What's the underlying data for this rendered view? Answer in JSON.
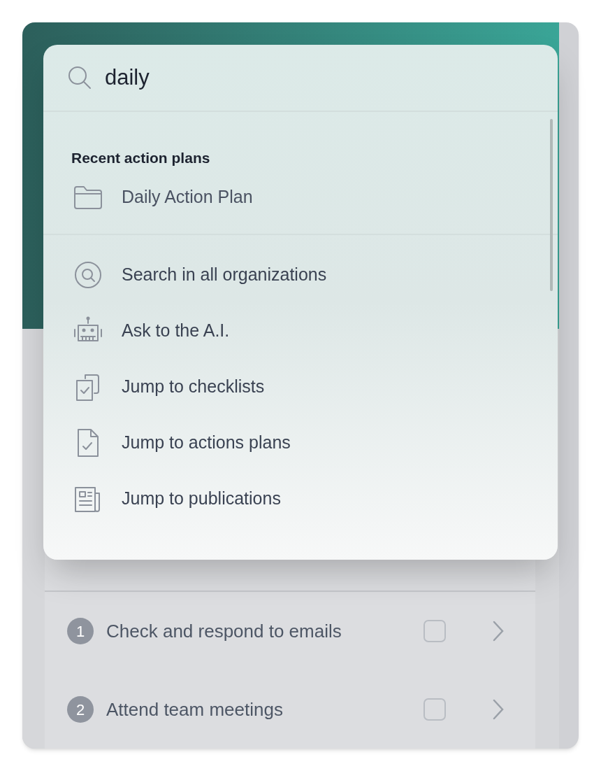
{
  "search": {
    "value": "daily"
  },
  "recent": {
    "heading": "Recent action plans",
    "items": [
      {
        "label": "Daily Action Plan"
      }
    ]
  },
  "actions": [
    {
      "label": "Search in all organizations"
    },
    {
      "label": "Ask to the A.I."
    },
    {
      "label": "Jump to checklists"
    },
    {
      "label": "Jump to actions plans"
    },
    {
      "label": "Jump to publications"
    }
  ],
  "tasks": [
    {
      "number": "1",
      "label": "Check and respond to emails",
      "checked": false
    },
    {
      "number": "2",
      "label": "Attend team meetings",
      "checked": false
    }
  ]
}
